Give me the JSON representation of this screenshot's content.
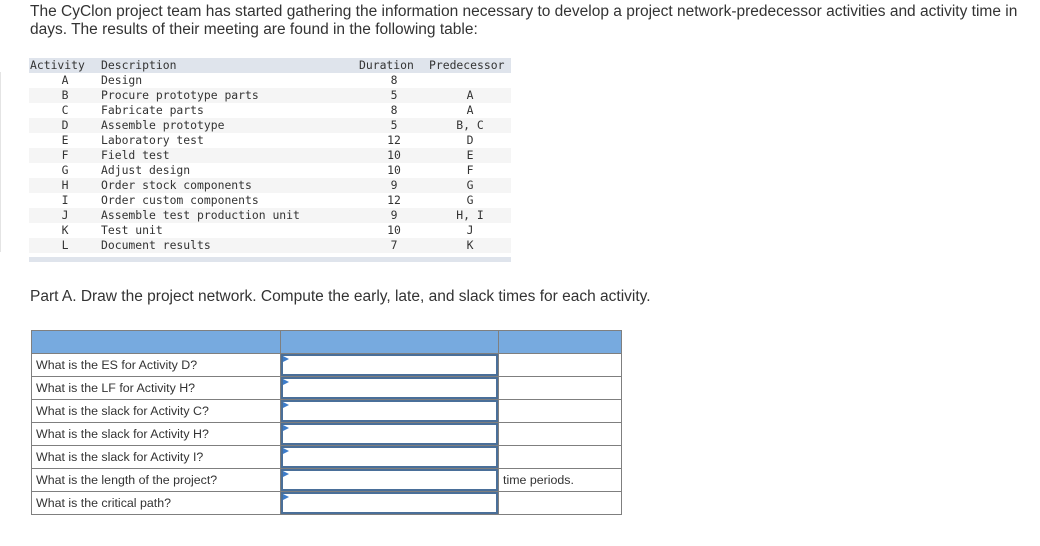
{
  "intro_text": "The CyClon project team has started gathering the information necessary to develop a project network-predecessor activities and activity time in days. The results of their meeting are found in the following table:",
  "activity_table": {
    "headers": {
      "activity": "Activity",
      "description": "Description",
      "duration": "Duration",
      "predecessor": "Predecessor"
    },
    "rows": [
      {
        "activity": "A",
        "description": "Design",
        "duration": "8",
        "predecessor": ""
      },
      {
        "activity": "B",
        "description": "Procure prototype parts",
        "duration": "5",
        "predecessor": "A"
      },
      {
        "activity": "C",
        "description": "Fabricate parts",
        "duration": "8",
        "predecessor": "A"
      },
      {
        "activity": "D",
        "description": "Assemble prototype",
        "duration": "5",
        "predecessor": "B, C"
      },
      {
        "activity": "E",
        "description": "Laboratory test",
        "duration": "12",
        "predecessor": "D"
      },
      {
        "activity": "F",
        "description": "Field test",
        "duration": "10",
        "predecessor": "E"
      },
      {
        "activity": "G",
        "description": "Adjust design",
        "duration": "10",
        "predecessor": "F"
      },
      {
        "activity": "H",
        "description": "Order stock components",
        "duration": "9",
        "predecessor": "G"
      },
      {
        "activity": "I",
        "description": "Order custom components",
        "duration": "12",
        "predecessor": "G"
      },
      {
        "activity": "J",
        "description": "Assemble test production unit",
        "duration": "9",
        "predecessor": "H, I"
      },
      {
        "activity": "K",
        "description": "Test unit",
        "duration": "10",
        "predecessor": "J"
      },
      {
        "activity": "L",
        "description": "Document results",
        "duration": "7",
        "predecessor": "K"
      }
    ]
  },
  "part_a_text": "Part A. Draw the project network. Compute the early, late, and slack times for each activity.",
  "questions": [
    {
      "question": "What is the ES for Activity D?",
      "answer": "",
      "unit": ""
    },
    {
      "question": "What is the LF for Activity H?",
      "answer": "",
      "unit": ""
    },
    {
      "question": "What is the slack for Activity C?",
      "answer": "",
      "unit": ""
    },
    {
      "question": "What is the slack for Activity H?",
      "answer": "",
      "unit": ""
    },
    {
      "question": "What is the slack for Activity I?",
      "answer": "",
      "unit": ""
    },
    {
      "question": "What is the length of the project?",
      "answer": "",
      "unit": "time periods."
    },
    {
      "question": "What is the critical path?",
      "answer": "",
      "unit": ""
    }
  ],
  "colors": {
    "header_bar": "#77aadf",
    "input_border": "#4a6f99",
    "input_flag": "#3d7cc9"
  }
}
